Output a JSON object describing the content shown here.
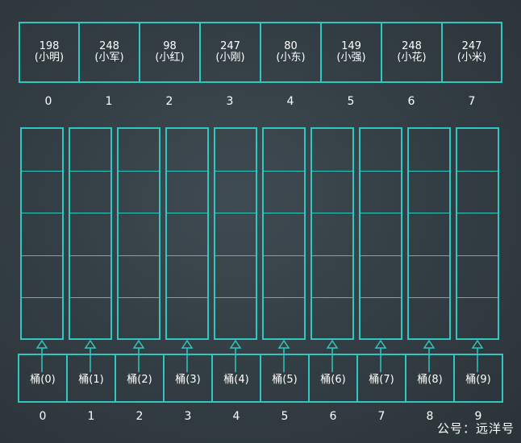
{
  "array": [
    {
      "value": "198",
      "name": "(小明)"
    },
    {
      "value": "248",
      "name": "(小军)"
    },
    {
      "value": "98",
      "name": "(小红)"
    },
    {
      "value": "247",
      "name": "(小刚)"
    },
    {
      "value": "80",
      "name": "(小东)"
    },
    {
      "value": "149",
      "name": "(小强)"
    },
    {
      "value": "248",
      "name": "(小花)"
    },
    {
      "value": "247",
      "name": "(小米)"
    }
  ],
  "array_indices": [
    "0",
    "1",
    "2",
    "3",
    "4",
    "5",
    "6",
    "7"
  ],
  "buckets": [
    "桶(0)",
    "桶(1)",
    "桶(2)",
    "桶(3)",
    "桶(4)",
    "桶(5)",
    "桶(6)",
    "桶(7)",
    "桶(8)",
    "桶(9)"
  ],
  "bucket_indices": [
    "0",
    "1",
    "2",
    "3",
    "4",
    "5",
    "6",
    "7",
    "8",
    "9"
  ],
  "watermark": "公号：远洋号",
  "colors": {
    "accent": "#2fc7c0",
    "text": "#ffffff",
    "background": "#343f45"
  }
}
